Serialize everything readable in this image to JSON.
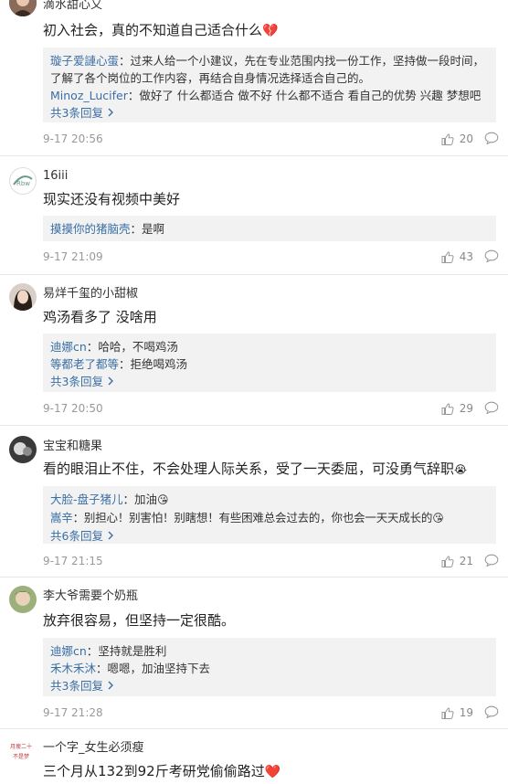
{
  "comments": [
    {
      "username": "滴水甜心又",
      "text": "初入社会，真的不知道自己适合什么",
      "emoji": "💔",
      "replies": [
        {
          "user": "璇子爱謰心蛋",
          "sep": "：",
          "text": "过来人给一个小建议，先在专业范围内找一份工作，坚持做一段时间，了解了各个岗位的工作内容，再结合自身情况选择适合自己的。"
        },
        {
          "user": "Minoz_Lucifer",
          "sep": "：",
          "text": "做好了 什么都适合 做不好 什么都不适合 看自己的优势 兴趣 梦想吧"
        }
      ],
      "more": "共3条回复",
      "time": "9-17 20:56",
      "likes": "20"
    },
    {
      "username": "16iii",
      "text": "现实还没有视频中美好",
      "replies": [
        {
          "user": "摸摸你的猪脑壳",
          "sep": "：",
          "text": "是啊"
        }
      ],
      "time": "9-17 21:09",
      "likes": "43"
    },
    {
      "username": "易烊千玺的小甜椒",
      "text": "鸡汤看多了 没啥用",
      "replies": [
        {
          "user": "迪娜cn",
          "sep": "：",
          "text": "哈哈，不喝鸡汤"
        },
        {
          "user": "等都老了都等",
          "sep": "：",
          "text": "拒绝喝鸡汤"
        }
      ],
      "more": "共3条回复",
      "time": "9-17 20:50",
      "likes": "29"
    },
    {
      "username": "宝宝和糖果",
      "text": "看的眼泪止不住，不会处理人际关系，受了一天委屈，可没勇气辞职",
      "emoji": "😭",
      "replies": [
        {
          "user": "大脸-盘子猪儿",
          "sep": "：",
          "text": "加油",
          "emoji": "😘"
        },
        {
          "user": "嵩辛",
          "sep": "：",
          "text": "别担心！别害怕！别瞎想！有些困难总会过去的，你也会一天天成长的",
          "emoji": "😘"
        }
      ],
      "more": "共6条回复",
      "time": "9-17 21:15",
      "likes": "21"
    },
    {
      "username": "李大爷需要个奶瓶",
      "text": "放弃很容易，但坚持一定很酷。",
      "replies": [
        {
          "user": "迪娜cn",
          "sep": "：",
          "text": "坚持就是胜利"
        },
        {
          "user": "禾木禾沐",
          "sep": "：",
          "text": "嗯嗯，加油坚持下去"
        }
      ],
      "more": "共3条回复",
      "time": "9-17 21:28",
      "likes": "19"
    },
    {
      "username": "一个字_女生必须瘦",
      "text": "三个月从132到92斤考研党偷偷路过",
      "emoji": "❤️",
      "avatar_text": "月瘦二十\n不是梦"
    }
  ],
  "icons": {
    "like": "thumb-up-icon",
    "comment": "comment-bubble-icon",
    "more": "chevron-right-icon"
  }
}
